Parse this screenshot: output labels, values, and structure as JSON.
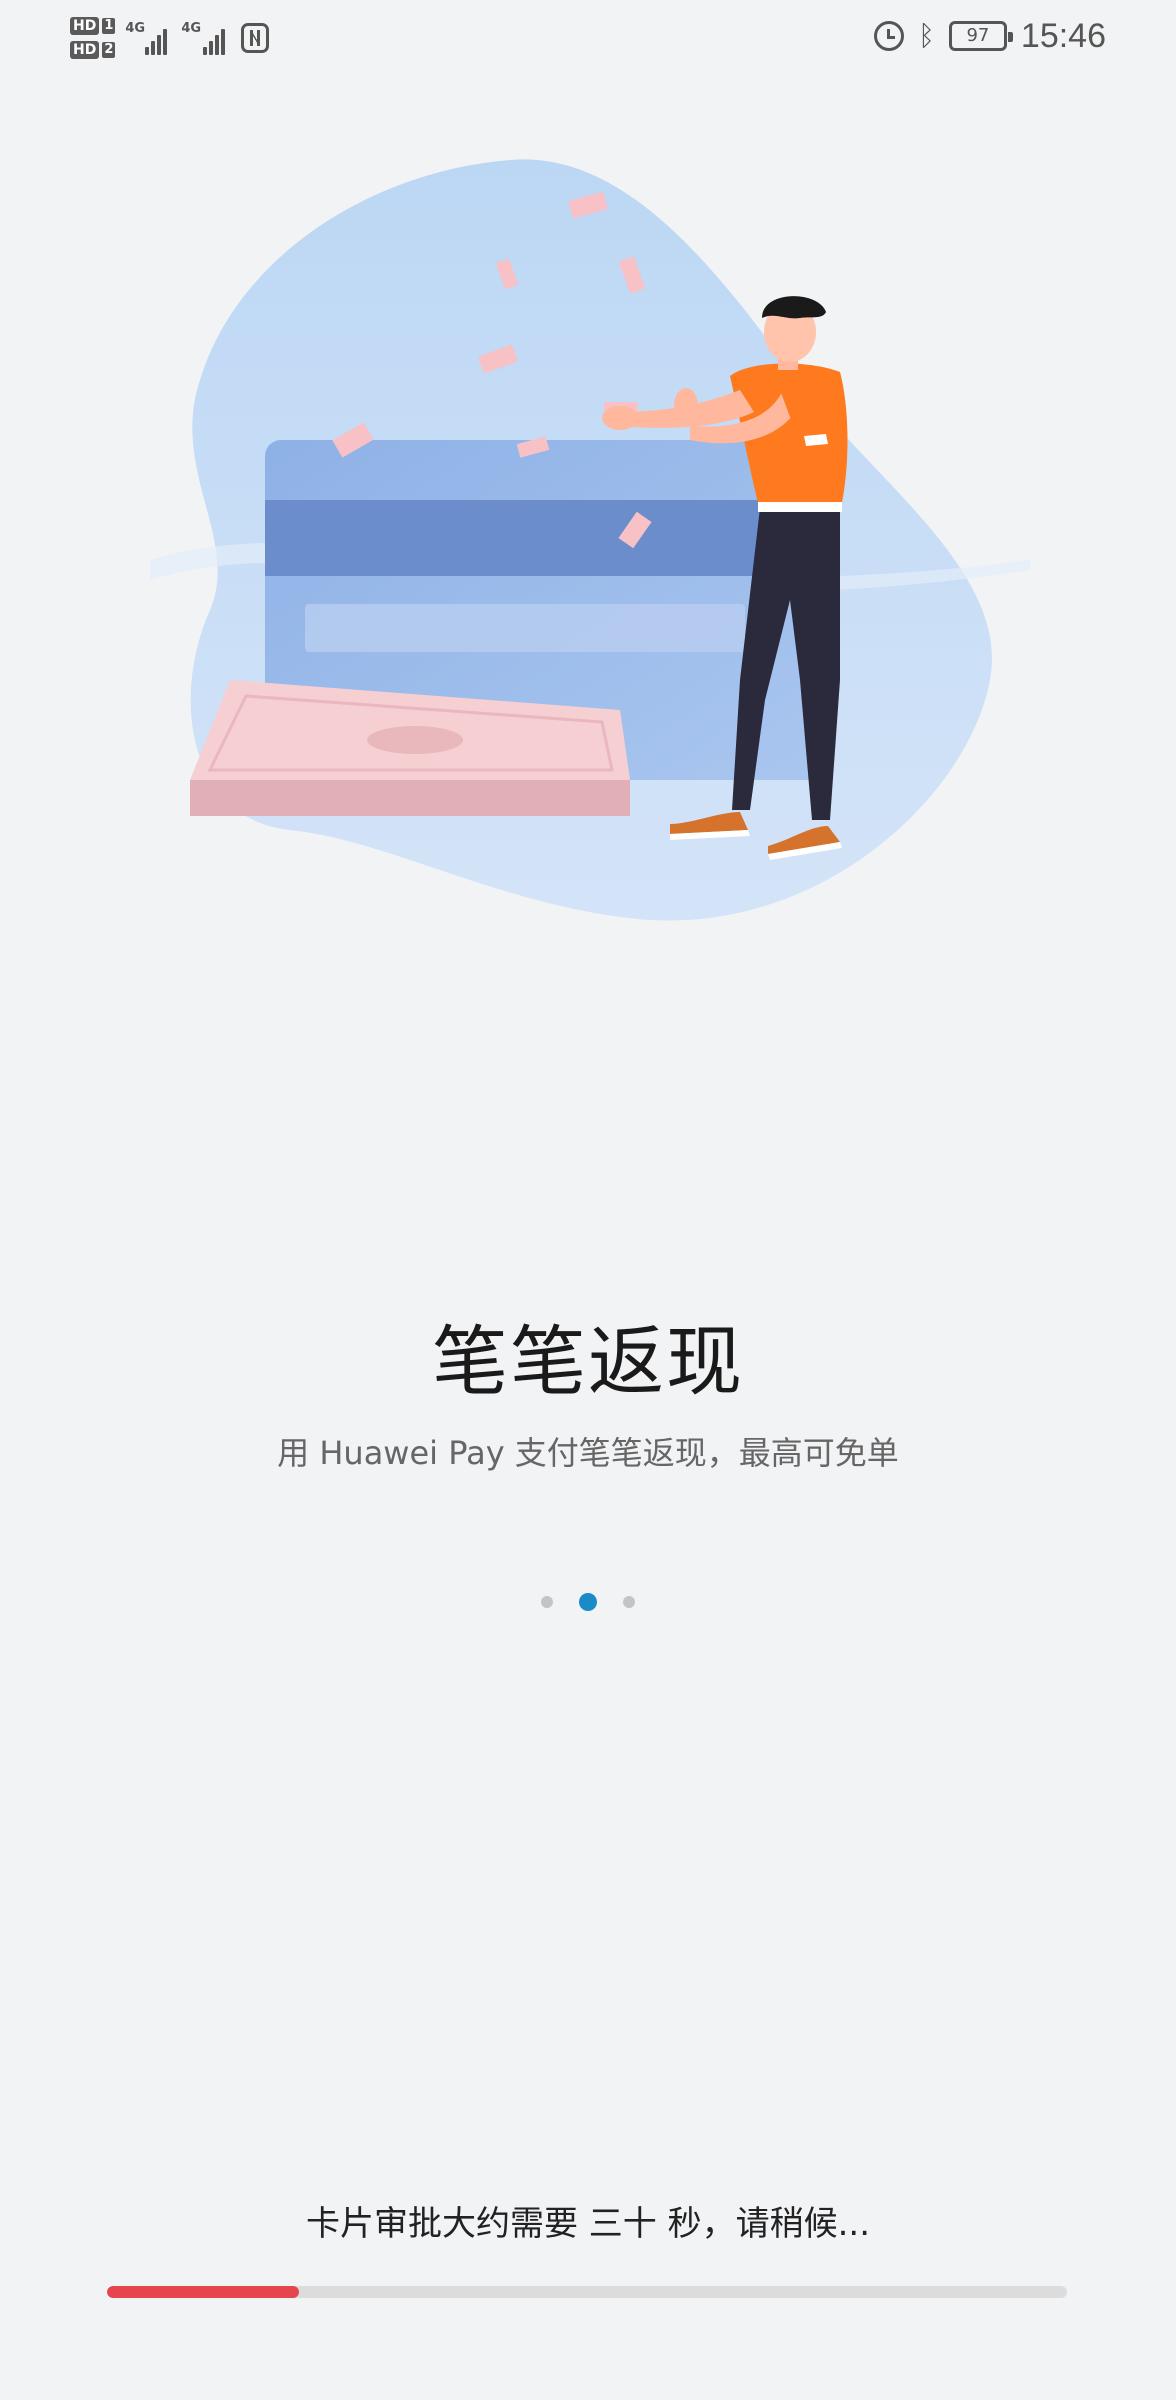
{
  "status_bar": {
    "sim1_label": "HD",
    "sim1_num": "1",
    "sim2_label": "HD",
    "sim2_num": "2",
    "network1": "4G",
    "network2": "4G",
    "battery_level": "97",
    "time": "15:46",
    "icons": [
      "sim-hd-icon",
      "signal-icon",
      "nfc-icon",
      "alarm-icon",
      "bluetooth-icon",
      "battery-icon"
    ]
  },
  "onboarding": {
    "title": "笔笔返现",
    "subtitle": "用 Huawei Pay 支付笔笔返现，最高可免单",
    "pages": 3,
    "active_page": 1
  },
  "loading": {
    "message": "卡片审批大约需要 三十 秒，请稍候...",
    "progress": 0.2
  },
  "colors": {
    "background": "#f2f3f5",
    "accent_dot": "#1a8bc6",
    "progress_fill": "#e5464e",
    "progress_track": "#dcdcdc"
  }
}
